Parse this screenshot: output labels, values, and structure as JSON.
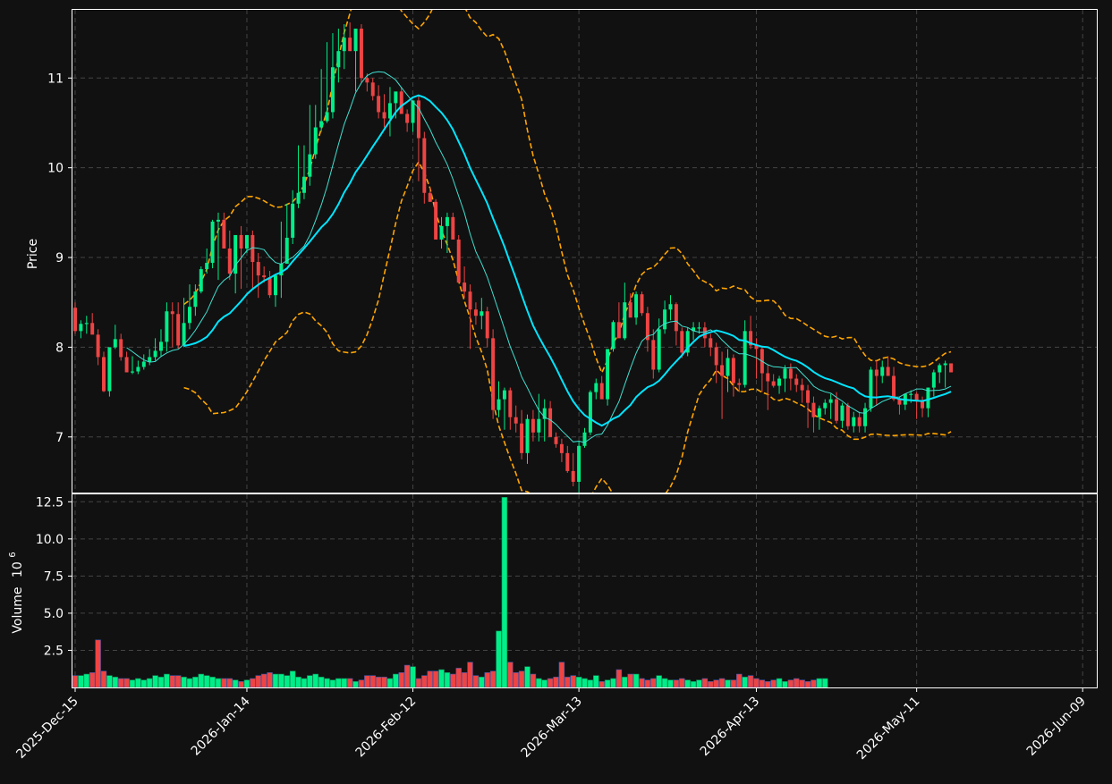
{
  "chart_data": {
    "type": "candlestick",
    "ylabel": "Price",
    "volume_label": "Volume",
    "volume_exponent_label": "10",
    "volume_exponent_sup": "6",
    "xlim": [
      "2025-12-15",
      "2026-06-11"
    ],
    "ylim": [
      6.38,
      11.76
    ],
    "volume_ylim": [
      0,
      13.0
    ],
    "price_ticks": [
      7,
      8,
      9,
      10,
      11
    ],
    "volume_ticks": [
      2.5,
      5.0,
      7.5,
      10.0,
      12.5
    ],
    "x_tick_labels": [
      {
        "date": "2025-12-15",
        "label": "2025-Dec-15"
      },
      {
        "date": "2026-01-14",
        "label": "2026-Jan-14"
      },
      {
        "date": "2026-02-12",
        "label": "2026-Feb-12"
      },
      {
        "date": "2026-03-13",
        "label": "2026-Mar-13"
      },
      {
        "date": "2026-04-13",
        "label": "2026-Apr-13"
      },
      {
        "date": "2026-05-11",
        "label": "2026-May-11"
      },
      {
        "date": "2026-06-09",
        "label": "2026-Jun-09"
      }
    ],
    "grid": true,
    "colors": {
      "background": "#111111",
      "up": "#00ee88",
      "down": "#ee4444",
      "ma_fast": "#40e0d0",
      "ma_slow": "#00e5ff",
      "bollinger": "#ffa500",
      "axes": "#ffffff",
      "grid": "#444444"
    },
    "series": [
      {
        "kind": "ohlc",
        "dates": [
          "2025-12-15",
          "2025-12-16",
          "2025-12-17",
          "2025-12-18",
          "2025-12-19",
          "2025-12-20",
          "2025-12-21",
          "2025-12-22",
          "2025-12-23",
          "2025-12-24",
          "2025-12-25",
          "2025-12-26",
          "2025-12-27",
          "2025-12-28",
          "2025-12-29",
          "2025-12-30",
          "2025-12-31",
          "2026-01-01",
          "2026-01-02",
          "2026-01-03",
          "2026-01-04",
          "2026-01-05",
          "2026-01-06",
          "2026-01-07",
          "2026-01-08",
          "2026-01-09",
          "2026-01-10",
          "2026-01-11",
          "2026-01-12",
          "2026-01-13",
          "2026-01-14",
          "2026-01-15",
          "2026-01-16",
          "2026-01-17",
          "2026-01-18",
          "2026-01-19",
          "2026-01-20",
          "2026-01-21",
          "2026-01-22",
          "2026-01-23",
          "2026-01-24",
          "2026-01-25",
          "2026-01-26",
          "2026-01-27",
          "2026-01-28",
          "2026-01-29",
          "2026-01-30",
          "2026-01-31",
          "2026-02-01",
          "2026-02-02",
          "2026-02-03",
          "2026-02-04",
          "2026-02-05",
          "2026-02-06",
          "2026-02-07",
          "2026-02-08",
          "2026-02-09",
          "2026-02-10",
          "2026-02-11",
          "2026-02-12",
          "2026-02-13",
          "2026-02-14",
          "2026-02-15",
          "2026-02-16",
          "2026-02-17",
          "2026-02-18",
          "2026-02-19",
          "2026-02-20",
          "2026-02-21",
          "2026-02-22",
          "2026-02-23",
          "2026-02-24",
          "2026-02-25",
          "2026-02-26",
          "2026-02-27",
          "2026-02-28",
          "2026-03-01",
          "2026-03-02",
          "2026-03-03",
          "2026-03-04",
          "2026-03-05",
          "2026-03-06",
          "2026-03-07",
          "2026-03-08",
          "2026-03-09",
          "2026-03-10",
          "2026-03-11",
          "2026-03-12",
          "2026-03-13",
          "2026-03-14",
          "2026-03-15",
          "2026-03-16",
          "2026-03-17",
          "2026-03-18",
          "2026-03-19",
          "2026-03-20",
          "2026-03-21",
          "2026-03-22",
          "2026-03-23",
          "2026-03-24",
          "2026-03-25",
          "2026-03-26",
          "2026-03-27",
          "2026-03-28",
          "2026-03-29",
          "2026-03-30",
          "2026-03-31",
          "2026-04-01",
          "2026-04-02",
          "2026-04-03",
          "2026-04-04",
          "2026-04-05",
          "2026-04-06",
          "2026-04-07",
          "2026-04-08",
          "2026-04-09",
          "2026-04-10",
          "2026-04-11",
          "2026-04-12",
          "2026-04-13",
          "2026-04-14",
          "2026-04-15",
          "2026-04-16",
          "2026-04-17",
          "2026-04-18",
          "2026-04-19",
          "2026-04-20",
          "2026-04-21",
          "2026-04-22",
          "2026-04-23",
          "2026-04-24",
          "2026-04-25",
          "2026-04-26",
          "2026-04-27",
          "2026-04-28",
          "2026-04-29",
          "2026-04-30",
          "2026-05-01",
          "2026-05-02",
          "2026-05-03",
          "2026-05-04",
          "2026-05-05",
          "2026-05-06",
          "2026-05-07",
          "2026-05-08",
          "2026-05-09",
          "2026-05-10",
          "2026-05-11",
          "2026-05-12",
          "2026-05-13",
          "2026-05-14",
          "2026-05-15",
          "2026-05-16",
          "2026-05-17",
          "2026-05-18",
          "2026-05-19",
          "2026-05-20",
          "2026-05-21",
          "2026-05-22",
          "2026-05-23",
          "2026-05-24",
          "2026-05-25",
          "2026-05-26",
          "2026-05-27",
          "2026-05-28",
          "2026-05-29",
          "2026-05-30",
          "2026-05-31",
          "2026-06-01",
          "2026-06-02",
          "2026-06-03",
          "2026-06-04",
          "2026-06-05",
          "2026-06-06",
          "2026-06-07",
          "2026-06-08",
          "2026-06-09",
          "2026-06-10",
          "2026-06-11"
        ],
        "open": [
          8.44,
          8.18,
          8.26,
          8.27,
          8.14,
          7.89,
          7.51,
          8.0,
          8.09,
          7.89,
          7.72,
          7.73,
          7.78,
          7.84,
          7.89,
          7.96,
          8.06,
          8.4,
          8.37,
          8.02,
          8.27,
          8.45,
          8.62,
          8.87,
          8.94,
          9.4,
          9.42,
          9.1,
          8.82,
          9.25,
          9.1,
          9.25,
          8.95,
          8.8,
          8.78,
          8.58,
          8.8,
          8.93,
          9.22,
          9.6,
          9.72,
          9.9,
          10.15,
          10.45,
          10.52,
          10.62,
          11.12,
          11.3,
          11.45,
          11.3,
          11.55,
          11.0,
          10.95,
          10.8,
          10.62,
          10.55,
          10.72,
          10.85,
          10.6,
          10.5,
          10.75,
          10.33,
          9.72,
          9.62,
          9.2,
          9.35,
          9.45,
          9.2,
          8.72,
          8.62,
          8.42,
          8.35,
          8.4,
          8.1,
          7.3,
          7.42,
          7.52,
          7.22,
          7.15,
          6.82,
          7.2,
          7.05,
          7.2,
          7.32,
          7.0,
          6.92,
          6.82,
          6.62,
          6.5,
          6.9,
          7.05,
          7.5,
          7.6,
          7.42,
          7.98,
          8.28,
          8.1,
          8.5,
          8.33,
          8.59,
          8.38,
          8.08,
          7.75,
          8.2,
          8.42,
          8.48,
          8.18,
          7.94,
          8.18,
          8.22,
          8.22,
          8.1,
          8.0,
          7.8,
          7.68,
          7.88,
          7.6,
          7.58,
          8.18,
          8.02,
          7.98,
          7.71,
          7.62,
          7.57,
          7.65,
          7.76,
          7.65,
          7.58,
          7.52,
          7.38,
          7.22,
          7.32,
          7.38,
          7.42,
          7.18,
          7.35,
          7.12,
          7.22,
          7.12,
          7.32,
          7.75,
          7.68,
          7.78,
          7.68,
          7.42,
          7.36,
          7.48,
          7.48,
          7.4,
          7.32,
          7.55,
          7.72,
          7.8,
          7.82
        ],
        "high": [
          8.5,
          8.3,
          8.35,
          8.38,
          8.2,
          7.95,
          7.78,
          8.25,
          8.15,
          7.95,
          7.9,
          7.85,
          7.92,
          7.98,
          8.1,
          8.2,
          8.5,
          8.5,
          8.5,
          8.55,
          8.7,
          8.7,
          8.9,
          9.1,
          9.42,
          9.5,
          9.5,
          9.3,
          9.0,
          9.35,
          9.25,
          9.3,
          9.05,
          8.9,
          8.85,
          8.75,
          9.4,
          9.6,
          9.75,
          10.25,
          10.25,
          10.7,
          10.7,
          11.1,
          11.4,
          11.5,
          11.55,
          11.6,
          11.62,
          11.55,
          11.6,
          11.05,
          11.0,
          10.92,
          10.82,
          10.9,
          10.78,
          10.9,
          10.65,
          10.72,
          10.8,
          10.4,
          9.78,
          9.65,
          9.45,
          9.5,
          9.5,
          9.25,
          8.9,
          8.7,
          8.5,
          8.55,
          8.45,
          8.2,
          7.62,
          7.55,
          7.55,
          7.35,
          7.3,
          7.25,
          7.3,
          7.48,
          7.42,
          7.4,
          7.05,
          6.98,
          6.9,
          6.82,
          6.95,
          7.1,
          7.52,
          7.65,
          7.68,
          7.58,
          8.3,
          8.5,
          8.72,
          8.6,
          8.62,
          8.62,
          8.45,
          8.2,
          8.32,
          8.52,
          8.58,
          8.5,
          8.22,
          8.22,
          8.28,
          8.28,
          8.28,
          8.15,
          8.05,
          7.95,
          7.98,
          7.92,
          7.65,
          8.3,
          8.35,
          8.1,
          8.0,
          7.8,
          7.7,
          7.68,
          7.8,
          7.82,
          7.7,
          7.65,
          7.58,
          7.45,
          7.35,
          7.42,
          7.48,
          7.5,
          7.38,
          7.38,
          7.28,
          7.28,
          7.38,
          7.78,
          7.85,
          7.85,
          7.9,
          7.78,
          7.45,
          7.48,
          7.52,
          7.5,
          7.45,
          7.55,
          7.75,
          7.82,
          7.85
        ],
        "low": [
          8.15,
          8.1,
          8.15,
          8.15,
          7.8,
          7.5,
          7.45,
          7.98,
          7.85,
          7.75,
          7.7,
          7.7,
          7.75,
          7.8,
          7.85,
          7.9,
          7.95,
          8.0,
          7.98,
          8.0,
          8.2,
          8.35,
          8.6,
          8.82,
          8.88,
          8.75,
          9.1,
          8.75,
          8.6,
          8.65,
          9.05,
          8.65,
          8.55,
          8.72,
          8.55,
          8.45,
          8.55,
          8.95,
          9.15,
          9.55,
          9.65,
          9.8,
          10.1,
          10.4,
          10.5,
          10.55,
          10.95,
          11.1,
          11.3,
          10.85,
          10.95,
          10.85,
          10.75,
          10.55,
          10.45,
          10.35,
          10.55,
          10.6,
          10.4,
          10.4,
          9.85,
          9.6,
          9.62,
          9.2,
          9.1,
          9.05,
          9.25,
          8.82,
          8.55,
          7.98,
          8.25,
          8.2,
          8.0,
          7.2,
          7.22,
          7.08,
          7.08,
          7.05,
          6.75,
          6.7,
          6.95,
          6.95,
          6.95,
          7.0,
          6.88,
          6.72,
          6.6,
          6.45,
          6.38,
          6.88,
          7.02,
          7.42,
          7.45,
          7.35,
          7.95,
          8.25,
          8.08,
          8.35,
          8.25,
          8.35,
          7.95,
          7.65,
          7.72,
          8.15,
          8.3,
          8.02,
          7.88,
          7.9,
          8.08,
          8.15,
          8.0,
          7.9,
          7.6,
          7.2,
          7.5,
          7.45,
          7.5,
          7.55,
          7.98,
          7.65,
          7.5,
          7.3,
          7.55,
          7.48,
          7.5,
          7.52,
          7.5,
          7.38,
          7.1,
          7.05,
          7.08,
          7.25,
          7.2,
          7.15,
          7.1,
          7.08,
          7.05,
          7.05,
          7.05,
          7.28,
          7.35,
          7.6,
          7.68,
          7.4,
          7.25,
          7.3,
          7.38,
          7.2,
          7.22,
          7.22,
          7.45,
          7.6,
          7.55
        ],
        "close": [
          8.18,
          8.26,
          8.27,
          8.14,
          7.89,
          7.51,
          8.0,
          8.09,
          7.89,
          7.72,
          7.73,
          7.78,
          7.84,
          7.89,
          7.96,
          8.06,
          8.4,
          8.37,
          8.02,
          8.27,
          8.45,
          8.62,
          8.87,
          8.94,
          9.4,
          9.42,
          9.1,
          8.82,
          9.25,
          9.1,
          9.25,
          8.95,
          8.8,
          8.78,
          8.58,
          8.8,
          8.93,
          9.22,
          9.6,
          9.72,
          9.9,
          10.15,
          10.45,
          10.52,
          10.62,
          11.12,
          11.3,
          11.45,
          11.3,
          11.55,
          11.0,
          10.95,
          10.8,
          10.62,
          10.55,
          10.72,
          10.85,
          10.6,
          10.5,
          10.75,
          10.33,
          9.72,
          9.62,
          9.2,
          9.35,
          9.45,
          9.2,
          8.72,
          8.62,
          8.42,
          8.35,
          8.4,
          8.1,
          7.3,
          7.42,
          7.52,
          7.22,
          7.15,
          6.82,
          7.2,
          7.05,
          7.2,
          7.32,
          7.0,
          6.92,
          6.82,
          6.62,
          6.5,
          6.9,
          7.05,
          7.5,
          7.6,
          7.42,
          7.98,
          8.28,
          8.1,
          8.5,
          8.33,
          8.59,
          8.38,
          8.08,
          7.75,
          8.2,
          8.42,
          8.48,
          8.18,
          7.94,
          8.18,
          8.22,
          8.22,
          8.1,
          8.0,
          7.8,
          7.68,
          7.88,
          7.6,
          7.58,
          8.18,
          8.02,
          7.98,
          7.71,
          7.62,
          7.57,
          7.65,
          7.76,
          7.65,
          7.58,
          7.52,
          7.38,
          7.22,
          7.32,
          7.38,
          7.42,
          7.18,
          7.35,
          7.12,
          7.22,
          7.12,
          7.32,
          7.75,
          7.68,
          7.78,
          7.68,
          7.42,
          7.36,
          7.48,
          7.48,
          7.4,
          7.32,
          7.55,
          7.72,
          7.8,
          7.82,
          7.72
        ],
        "volume": [
          0.8,
          0.8,
          0.9,
          1.0,
          3.2,
          1.1,
          0.8,
          0.7,
          0.6,
          0.6,
          0.5,
          0.6,
          0.5,
          0.6,
          0.8,
          0.7,
          0.9,
          0.8,
          0.8,
          0.7,
          0.6,
          0.7,
          0.9,
          0.8,
          0.7,
          0.6,
          0.6,
          0.6,
          0.5,
          0.4,
          0.5,
          0.6,
          0.8,
          0.9,
          1.0,
          0.9,
          0.9,
          0.8,
          1.1,
          0.7,
          0.6,
          0.8,
          0.9,
          0.7,
          0.6,
          0.5,
          0.6,
          0.6,
          0.6,
          0.4,
          0.5,
          0.8,
          0.8,
          0.7,
          0.7,
          0.6,
          0.9,
          1.0,
          1.5,
          1.4,
          0.6,
          0.8,
          1.1,
          1.1,
          1.2,
          1.0,
          0.9,
          1.3,
          1.0,
          1.7,
          0.8,
          0.7,
          1.0,
          1.1,
          3.8,
          12.8,
          1.7,
          1.0,
          1.1,
          1.4,
          0.9,
          0.6,
          0.5,
          0.6,
          0.7,
          1.7,
          0.7,
          0.8,
          0.7,
          0.6,
          0.5,
          0.8,
          0.4,
          0.5,
          0.6,
          1.2,
          0.7,
          0.9,
          0.9,
          0.6,
          0.5,
          0.6,
          0.8,
          0.6,
          0.5,
          0.5,
          0.6,
          0.5,
          0.4,
          0.5,
          0.6,
          0.4,
          0.5,
          0.6,
          0.5,
          0.5,
          0.9,
          0.7,
          0.8,
          0.6,
          0.5,
          0.4,
          0.5,
          0.6,
          0.4,
          0.5,
          0.6,
          0.5,
          0.4,
          0.5,
          0.6,
          0.6
        ]
      },
      {
        "kind": "line",
        "role": "ma_fast"
      },
      {
        "kind": "line",
        "role": "ma_slow"
      },
      {
        "kind": "band",
        "role": "bollinger"
      }
    ]
  }
}
